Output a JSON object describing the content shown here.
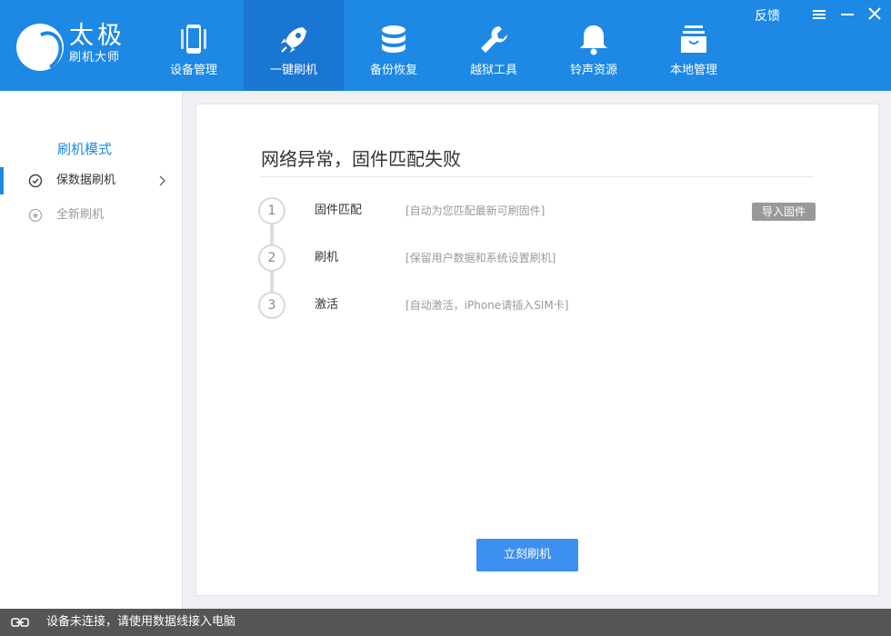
{
  "header": {
    "logo_title": "太极",
    "logo_subtitle": "刷机大师",
    "feedback_label": "反馈",
    "nav": [
      {
        "label": "设备管理",
        "icon": "phone-icon"
      },
      {
        "label": "一键刷机",
        "icon": "rocket-icon",
        "active": true
      },
      {
        "label": "备份恢复",
        "icon": "database-icon"
      },
      {
        "label": "越狱工具",
        "icon": "wrench-icon"
      },
      {
        "label": "铃声资源",
        "icon": "bell-icon"
      },
      {
        "label": "本地管理",
        "icon": "shopping-bag-icon"
      }
    ],
    "window_controls": [
      "menu-icon",
      "minimize-icon",
      "close-icon"
    ]
  },
  "sidebar": {
    "title": "刷机模式",
    "items": [
      {
        "label": "保数据刷机",
        "icon": "check-circle-icon",
        "selected": true
      },
      {
        "label": "全新刷机",
        "icon": "star-circle-icon",
        "selected": false
      }
    ]
  },
  "main": {
    "title": "网络异常，固件匹配失败",
    "steps": [
      {
        "num": "1",
        "name": "固件匹配",
        "desc": "[自动为您匹配最新可刷固件]"
      },
      {
        "num": "2",
        "name": "刷机",
        "desc": "[保留用户数据和系统设置刷机]"
      },
      {
        "num": "3",
        "name": "激活",
        "desc": "[自动激活，iPhone请插入SIM卡]"
      }
    ],
    "import_button": "导入固件",
    "flash_button": "立刻刷机"
  },
  "status": {
    "text": "设备未连接，请使用数据线接入电脑",
    "icon": "link-icon"
  },
  "colors": {
    "accent": "#1e88e5",
    "accent_active": "#1976d2",
    "button_primary": "#3d8ff0",
    "statusbar": "#555555"
  }
}
